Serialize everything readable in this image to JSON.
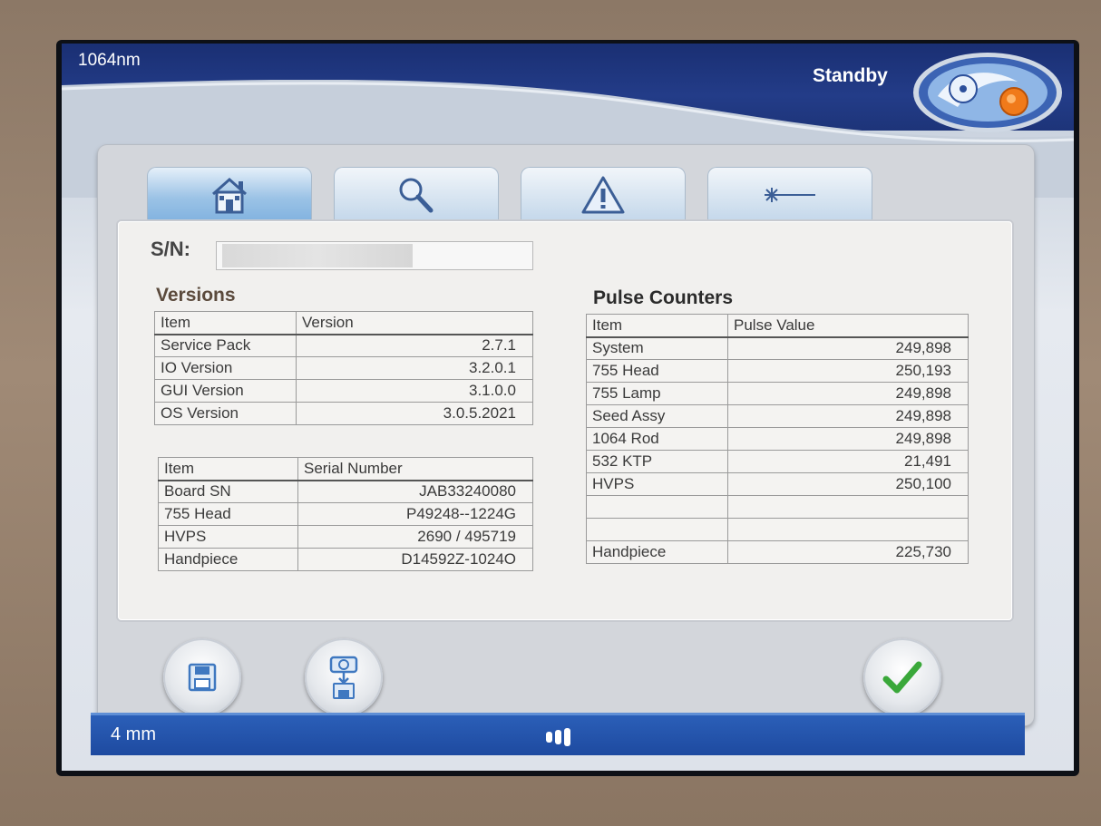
{
  "header": {
    "wavelength": "1064nm",
    "status": "Standby"
  },
  "tabs": [
    {
      "icon": "home-icon",
      "active": true
    },
    {
      "icon": "search-icon",
      "active": false
    },
    {
      "icon": "warning-icon",
      "active": false
    },
    {
      "icon": "laser-beam-icon",
      "active": false
    }
  ],
  "sn": {
    "label": "S/N:",
    "value": ""
  },
  "versions": {
    "title": "Versions",
    "headers": [
      "Item",
      "Version"
    ],
    "rows": [
      [
        "Service Pack",
        "2.7.1"
      ],
      [
        "IO Version",
        "3.2.0.1"
      ],
      [
        "GUI Version",
        "3.1.0.0"
      ],
      [
        "OS Version",
        "3.0.5.2021"
      ]
    ]
  },
  "serials": {
    "headers": [
      "Item",
      "Serial Number"
    ],
    "rows": [
      [
        "Board SN",
        "JAB33240080"
      ],
      [
        "755 Head",
        "P49248--1224G"
      ],
      [
        "HVPS",
        "2690 / 495719"
      ],
      [
        "Handpiece",
        "D14592Z-1024O"
      ]
    ]
  },
  "pulse": {
    "title": "Pulse Counters",
    "headers": [
      "Item",
      "Pulse Value"
    ],
    "rows": [
      [
        "System",
        "249,898"
      ],
      [
        "755 Head",
        "250,193"
      ],
      [
        "755 Lamp",
        "249,898"
      ],
      [
        "Seed Assy",
        "249,898"
      ],
      [
        "1064 Rod",
        "249,898"
      ],
      [
        "532 KTP",
        "21,491"
      ],
      [
        "HVPS",
        "250,100"
      ],
      [
        "",
        ""
      ],
      [
        "",
        ""
      ],
      [
        "Handpiece",
        "225,730"
      ]
    ]
  },
  "footer": {
    "spot_size": "4 mm"
  },
  "colors": {
    "header_blue": "#1d3479",
    "footer_blue": "#1e4aa0",
    "check_green": "#3aa83a",
    "logo_orange": "#f07a1a"
  }
}
